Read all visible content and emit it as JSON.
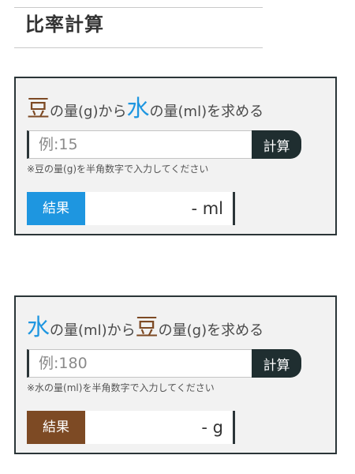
{
  "page": {
    "title": "比率計算"
  },
  "calculators": [
    {
      "heading": {
        "from_keyword": "豆",
        "from_text": "の量(g)から",
        "to_keyword": "水",
        "to_text": "の量(ml)を求める"
      },
      "input": {
        "value": "",
        "placeholder": "例:15"
      },
      "button_label": "計算",
      "hint": "※豆の量(g)を半角数字で入力してください",
      "result": {
        "label": "結果",
        "value": "-",
        "unit": "ml"
      },
      "label_color": "#1e96e0"
    },
    {
      "heading": {
        "from_keyword": "水",
        "from_text": "の量(ml)から",
        "to_keyword": "豆",
        "to_text": "の量(g)を求める"
      },
      "input": {
        "value": "",
        "placeholder": "例:180"
      },
      "button_label": "計算",
      "hint": "※水の量(ml)を半角数字で入力してください",
      "result": {
        "label": "結果",
        "value": "-",
        "unit": "g"
      },
      "label_color": "#7d4a24"
    }
  ],
  "colors": {
    "bean_brown": "#7d4a24",
    "water_blue": "#1e96e0",
    "dark_teal": "#1f2e30",
    "panel_bg": "#f2f2f2"
  }
}
